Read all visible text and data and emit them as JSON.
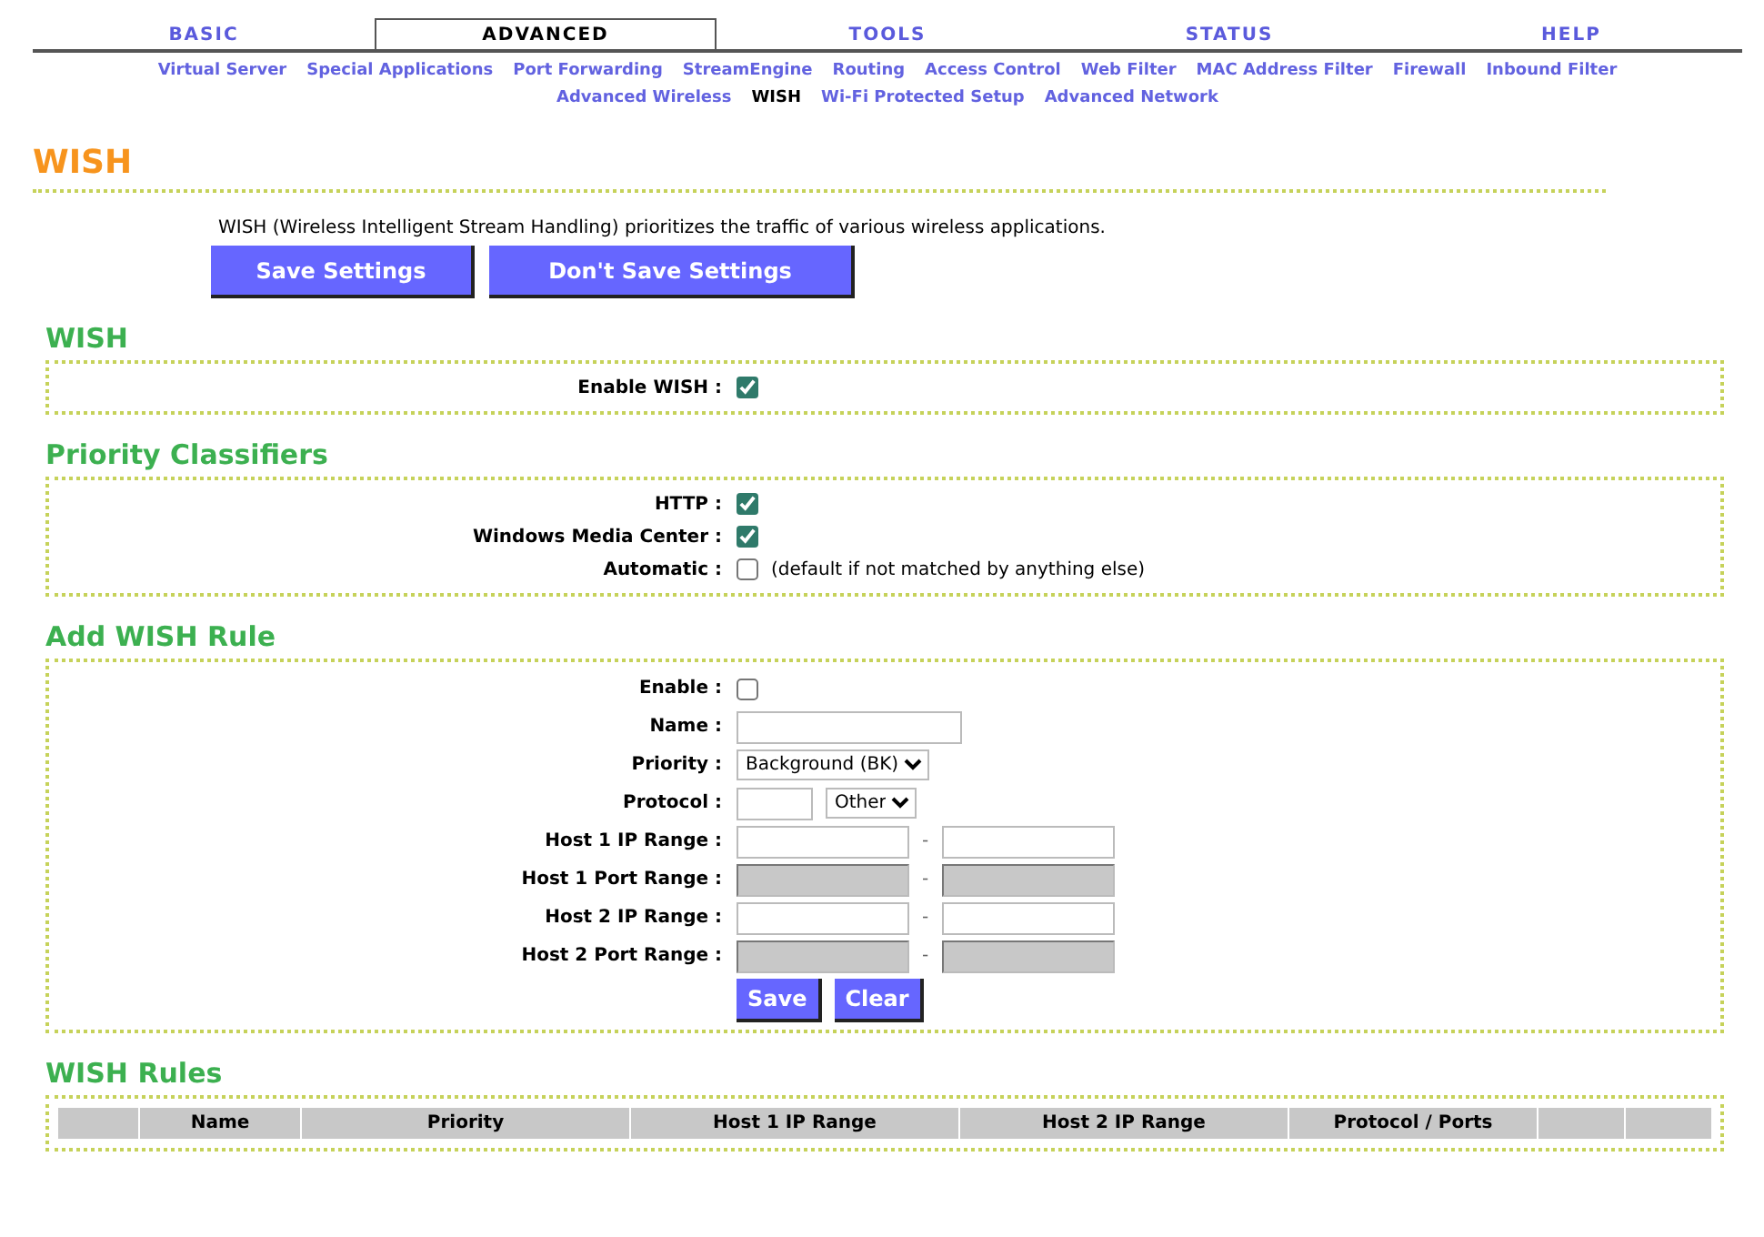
{
  "nav": {
    "tabs": [
      {
        "label": "BASIC",
        "selected": false
      },
      {
        "label": "ADVANCED",
        "selected": true
      },
      {
        "label": "TOOLS",
        "selected": false
      },
      {
        "label": "STATUS",
        "selected": false
      },
      {
        "label": "HELP",
        "selected": false
      }
    ],
    "links": [
      {
        "label": "Virtual Server",
        "selected": false
      },
      {
        "label": "Special Applications",
        "selected": false
      },
      {
        "label": "Port Forwarding",
        "selected": false
      },
      {
        "label": "StreamEngine",
        "selected": false
      },
      {
        "label": "Routing",
        "selected": false
      },
      {
        "label": "Access Control",
        "selected": false
      },
      {
        "label": "Web Filter",
        "selected": false
      },
      {
        "label": "MAC Address Filter",
        "selected": false
      },
      {
        "label": "Firewall",
        "selected": false
      },
      {
        "label": "Inbound Filter",
        "selected": false
      },
      {
        "label": "Advanced Wireless",
        "selected": false
      },
      {
        "label": "WISH",
        "selected": true
      },
      {
        "label": "Wi-Fi Protected Setup",
        "selected": false
      },
      {
        "label": "Advanced Network",
        "selected": false
      }
    ]
  },
  "page_title": "WISH",
  "description": "WISH (Wireless Intelligent Stream Handling) prioritizes the traffic of various wireless applications.",
  "buttons": [
    "Save Settings",
    "Don't Save Settings"
  ],
  "wish": {
    "heading": "WISH",
    "fields": [
      {
        "label": "Enable WISH :",
        "checked": true
      }
    ]
  },
  "classifiers": {
    "heading": "Priority Classifiers",
    "fields": [
      {
        "label": "HTTP :",
        "checked": true
      },
      {
        "label": "Windows Media Center :",
        "checked": true
      },
      {
        "label": "Automatic :",
        "checked": false,
        "note": "(default if not matched by anything else)"
      }
    ]
  },
  "rule_form": {
    "heading": "Add WISH Rule",
    "fields": [
      {
        "kind": "checkbox",
        "label": "Enable :",
        "checked": false
      },
      {
        "kind": "text",
        "label": "Name :"
      },
      {
        "kind": "select",
        "label": "Priority :",
        "value": "Background (BK)"
      },
      {
        "kind": "protocol",
        "label": "Protocol :",
        "value": "Other"
      },
      {
        "kind": "range",
        "label": "Host 1 IP Range :",
        "separator": "-",
        "disabled": false
      },
      {
        "kind": "range",
        "label": "Host 1 Port Range :",
        "separator": "-",
        "disabled": true
      },
      {
        "kind": "range",
        "label": "Host 2 IP Range :",
        "separator": "-",
        "disabled": false
      },
      {
        "kind": "range",
        "label": "Host 2 Port Range :",
        "separator": "-",
        "disabled": true
      }
    ],
    "buttons": [
      "Save",
      "Clear"
    ]
  },
  "rules_table": {
    "heading": "WISH Rules",
    "columns": [
      "Name",
      "Priority",
      "Host 1 IP Range",
      "Host 2 IP Range",
      "Protocol / Ports"
    ]
  }
}
